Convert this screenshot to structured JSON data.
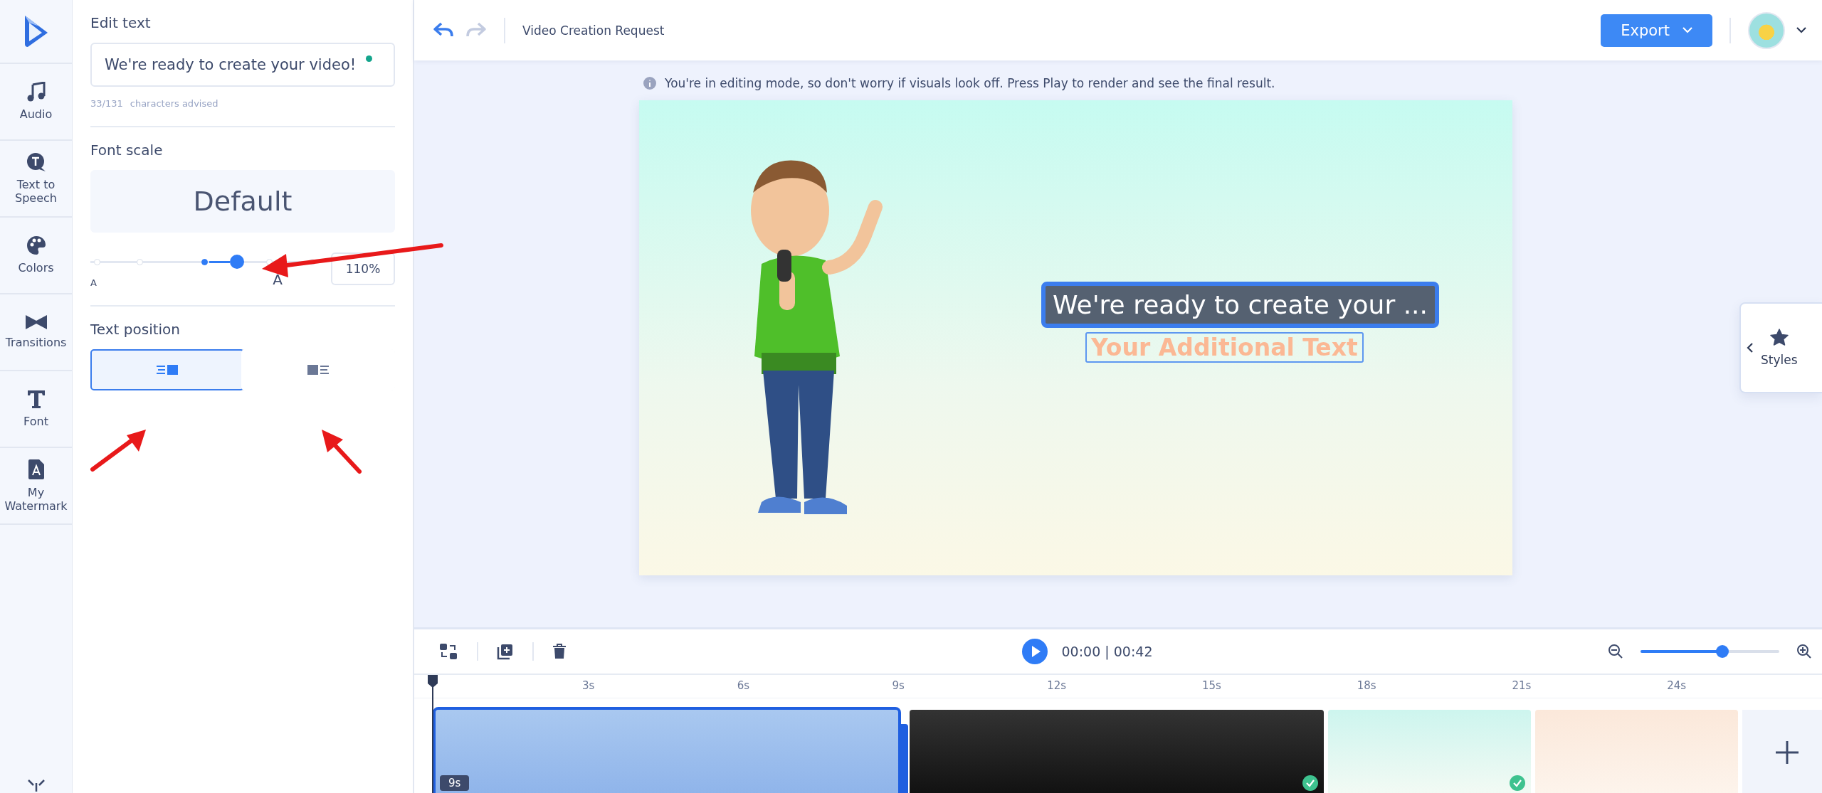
{
  "rail": {
    "items": [
      {
        "label": "Audio"
      },
      {
        "label": "Text to Speech"
      },
      {
        "label": "Colors"
      },
      {
        "label": "Transitions"
      },
      {
        "label": "Font"
      },
      {
        "label": "My Watermark"
      }
    ]
  },
  "panel": {
    "edit_text": {
      "title": "Edit text",
      "value": "We're ready to create your video!",
      "status_dot": true,
      "counter": "33/131",
      "counter_label": "characters advised"
    },
    "font_scale": {
      "title": "Font scale",
      "preset": "Default",
      "level": 0.65,
      "min_label": "A",
      "max_label": "A",
      "value": "110%"
    },
    "text_position": {
      "title": "Text position",
      "options": [
        {
          "kind": "text-left",
          "selected": true
        },
        {
          "kind": "text-right",
          "selected": false
        }
      ]
    }
  },
  "topbar": {
    "undo_disabled": false,
    "redo_disabled": true,
    "title": "Video Creation Request",
    "export": "Export"
  },
  "notice": "You're in editing mode, so don't worry if visuals look off. Press Play to render and see the final result.",
  "preview": {
    "main_text": "We're ready to create your ...",
    "main_selected": true,
    "additional_text": "Your Additional Text"
  },
  "styles_tab": {
    "label": "Styles"
  },
  "timeline": {
    "time": "00:00 | 00:42",
    "zoom": {
      "level": 0.59
    },
    "ticks": [
      "3s",
      "6s",
      "9s",
      "12s",
      "15s",
      "18s",
      "21s",
      "24s"
    ],
    "clips": [
      {
        "duration": "9s",
        "selected": true,
        "done": false
      },
      {
        "selected": false,
        "done": true
      },
      {
        "selected": false,
        "done": true
      },
      {
        "selected": false,
        "done": false
      }
    ]
  }
}
